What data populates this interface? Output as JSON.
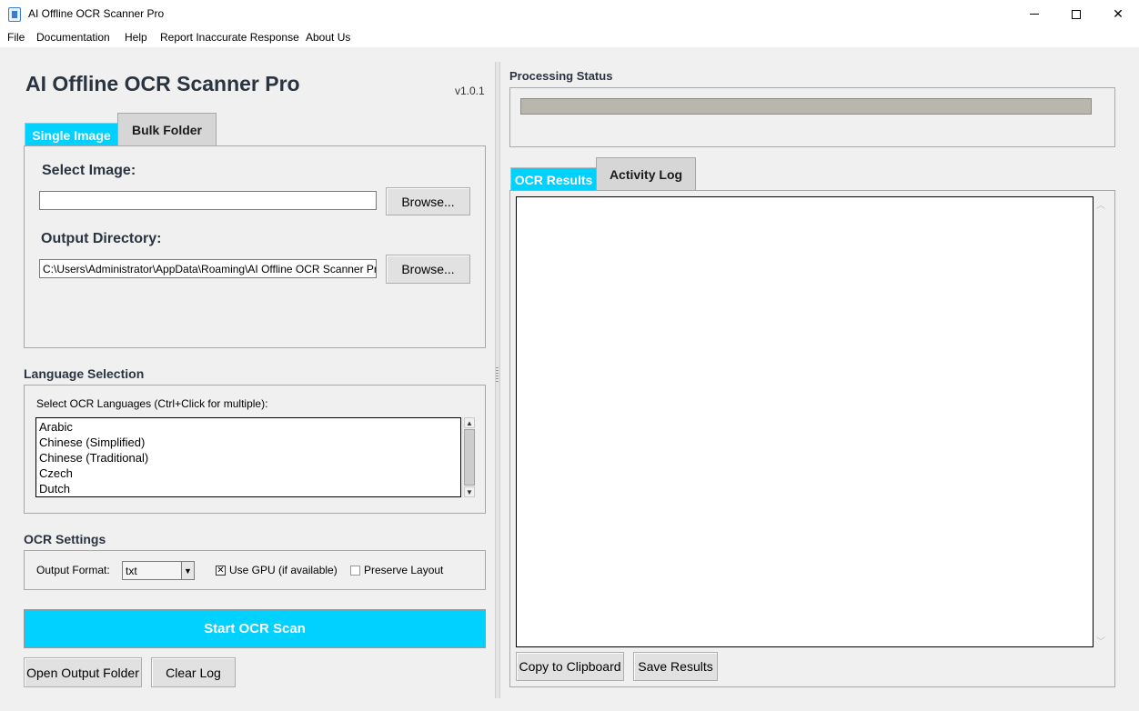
{
  "window": {
    "title": "AI Offline OCR Scanner Pro",
    "minimize": "–",
    "maximize": "□",
    "close": "✕"
  },
  "menu": [
    "File",
    "Documentation",
    "Help",
    "Report Inaccurate Response",
    "About Us"
  ],
  "header": {
    "title": "AI Offline OCR Scanner Pro",
    "version": "v1.0.1"
  },
  "left_tabs": [
    "Single Image",
    "Bulk Folder"
  ],
  "single_image": {
    "select_image_label": "Select Image:",
    "select_image_value": "",
    "browse_label": "Browse...",
    "output_dir_label": "Output Directory:",
    "output_dir_value": "C:\\Users\\Administrator\\AppData\\Roaming\\AI Offline OCR Scanner Pro",
    "browse2_label": "Browse..."
  },
  "language": {
    "section_title": "Language Selection",
    "hint": "Select OCR Languages (Ctrl+Click for multiple):",
    "items": [
      "Arabic",
      "Chinese (Simplified)",
      "Chinese (Traditional)",
      "Czech",
      "Dutch"
    ]
  },
  "ocr_settings": {
    "section_title": "OCR Settings",
    "format_label": "Output Format:",
    "format_value": "txt",
    "use_gpu_label": "Use GPU (if available)",
    "use_gpu_checked": true,
    "preserve_layout_label": "Preserve Layout",
    "preserve_layout_checked": false
  },
  "actions": {
    "start_label": "Start OCR Scan",
    "open_folder_label": "Open Output Folder",
    "clear_log_label": "Clear Log"
  },
  "status": {
    "title": "Processing Status",
    "progress": 0
  },
  "right_tabs": [
    "OCR Results",
    "Activity Log"
  ],
  "results": {
    "text": "",
    "copy_label": "Copy to Clipboard",
    "save_label": "Save Results"
  },
  "colors": {
    "accent": "#00d1ff",
    "title_text": "#2a3340",
    "progress_track": "#b9b6ad"
  }
}
